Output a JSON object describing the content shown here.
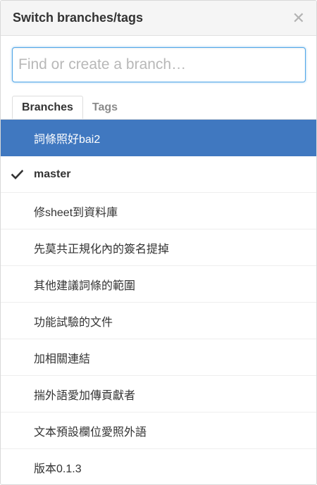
{
  "header": {
    "title": "Switch branches/tags",
    "close_glyph": "✕",
    "close_icon": "close-icon"
  },
  "filter": {
    "placeholder": "Find or create a branch…",
    "value": ""
  },
  "tabs": [
    {
      "label": "Branches",
      "active": true
    },
    {
      "label": "Tags",
      "active": false
    }
  ],
  "branches": [
    {
      "name": "詞條照好bai2",
      "selected": true,
      "current": false
    },
    {
      "name": "master",
      "selected": false,
      "current": true
    },
    {
      "name": "修sheet到資料庫",
      "selected": false,
      "current": false
    },
    {
      "name": "先莫共正規化內的簽名提掉",
      "selected": false,
      "current": false
    },
    {
      "name": "其他建議詞條的範圍",
      "selected": false,
      "current": false
    },
    {
      "name": "功能試驗的文件",
      "selected": false,
      "current": false
    },
    {
      "name": "加相關連結",
      "selected": false,
      "current": false
    },
    {
      "name": "揣外語愛加傳貢獻者",
      "selected": false,
      "current": false
    },
    {
      "name": "文本預設欄位愛照外語",
      "selected": false,
      "current": false
    },
    {
      "name": "版本0.1.3",
      "selected": false,
      "current": false
    }
  ],
  "icons": {
    "current_branch": "check-icon"
  },
  "colors": {
    "selected_bg": "#4078c0",
    "focus_border": "#51a7e8",
    "header_bg": "#f5f5f5"
  }
}
